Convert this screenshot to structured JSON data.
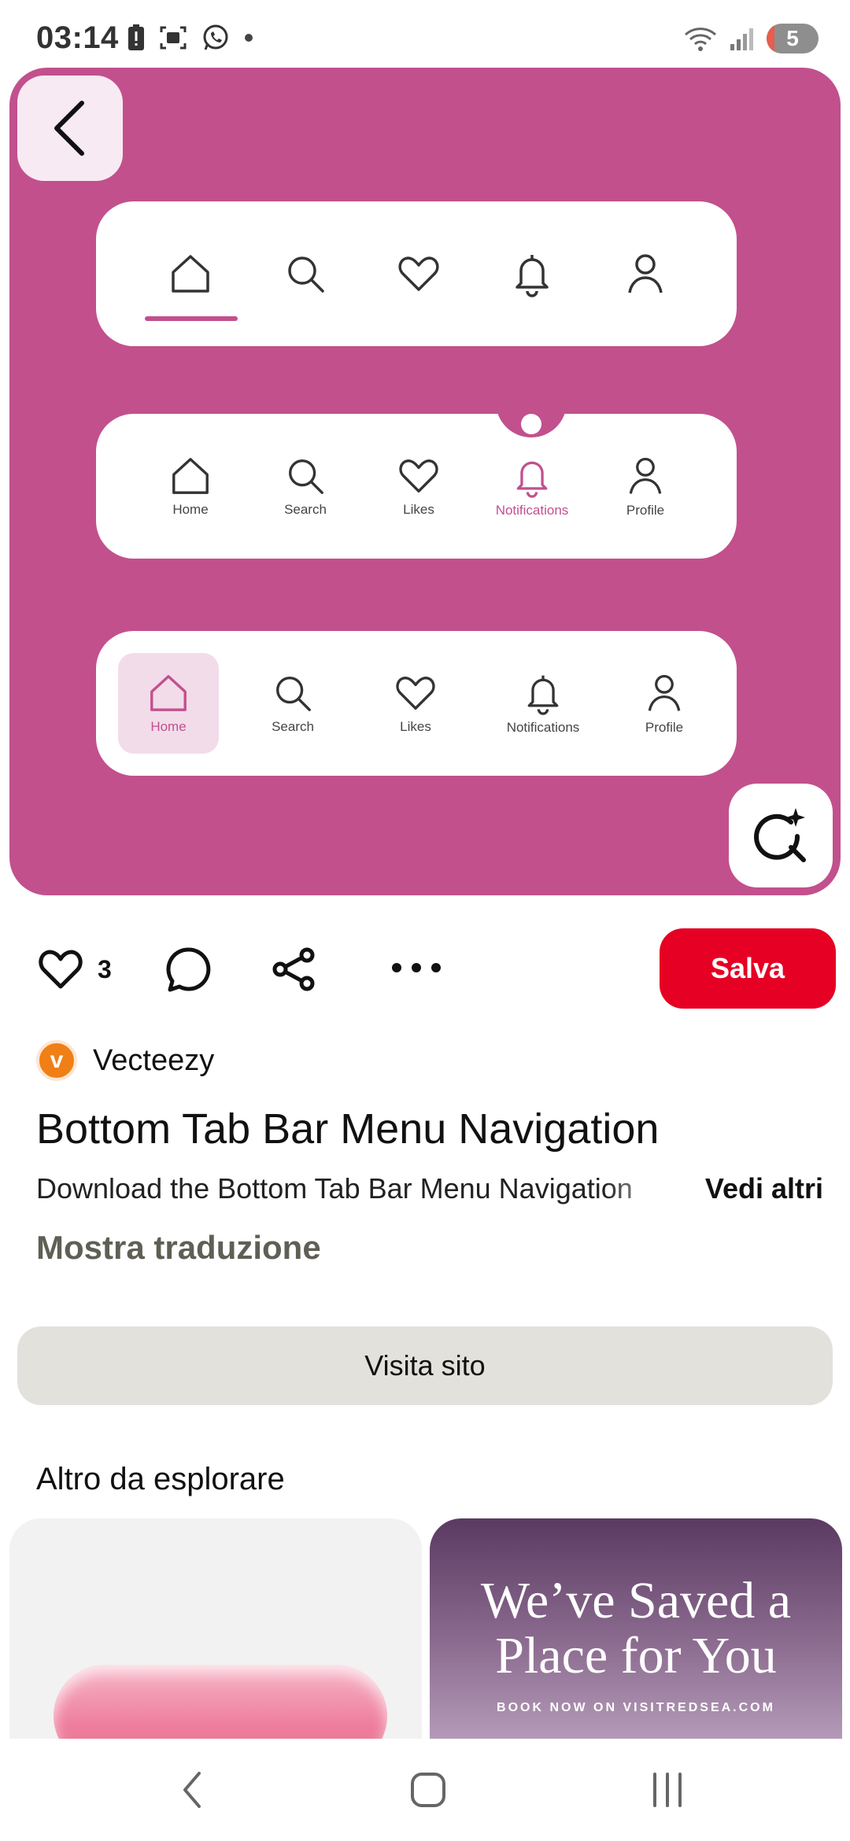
{
  "status_bar": {
    "time": "03:14",
    "battery_level": "5",
    "left_icons": [
      "alert-icon",
      "screenshot-icon",
      "whatsapp-icon",
      "dot-icon"
    ],
    "right_icons": [
      "wifi-icon",
      "signal-icon",
      "battery-icon"
    ]
  },
  "hero": {
    "background_color": "#c2508d",
    "accent_color": "#c2508d",
    "tab_bar_1": {
      "icons": [
        "home-icon",
        "search-icon",
        "heart-icon",
        "bell-icon",
        "profile-icon"
      ],
      "active_index": 0
    },
    "tab_bar_2": {
      "labels": [
        "Home",
        "Search",
        "Likes",
        "Notifications",
        "Profile"
      ],
      "active_index": 3
    },
    "tab_bar_3": {
      "labels": [
        "Home",
        "Search",
        "Likes",
        "Notifications",
        "Profile"
      ],
      "active_index": 0
    }
  },
  "actions": {
    "like_count": "3",
    "save_label": "Salva",
    "save_color": "#e60023"
  },
  "creator": {
    "avatar_letter": "v",
    "name": "Vecteezy"
  },
  "pin": {
    "title": "Bottom Tab Bar Menu Navigation",
    "description": "Download the Bottom Tab Bar Menu Navigation",
    "see_more": "Vedi altri",
    "translate": "Mostra traduzione",
    "visit_label": "Visita sito"
  },
  "explore": {
    "title": "Altro da esplorare",
    "cards": [
      {
        "headline": "",
        "sub": ""
      },
      {
        "headline": "We’ve Saved a Place for You",
        "sub": "BOOK NOW ON VISITREDSEA.COM"
      }
    ]
  },
  "navbar": {
    "buttons": [
      "back-icon",
      "home-icon",
      "recents-icon"
    ]
  }
}
